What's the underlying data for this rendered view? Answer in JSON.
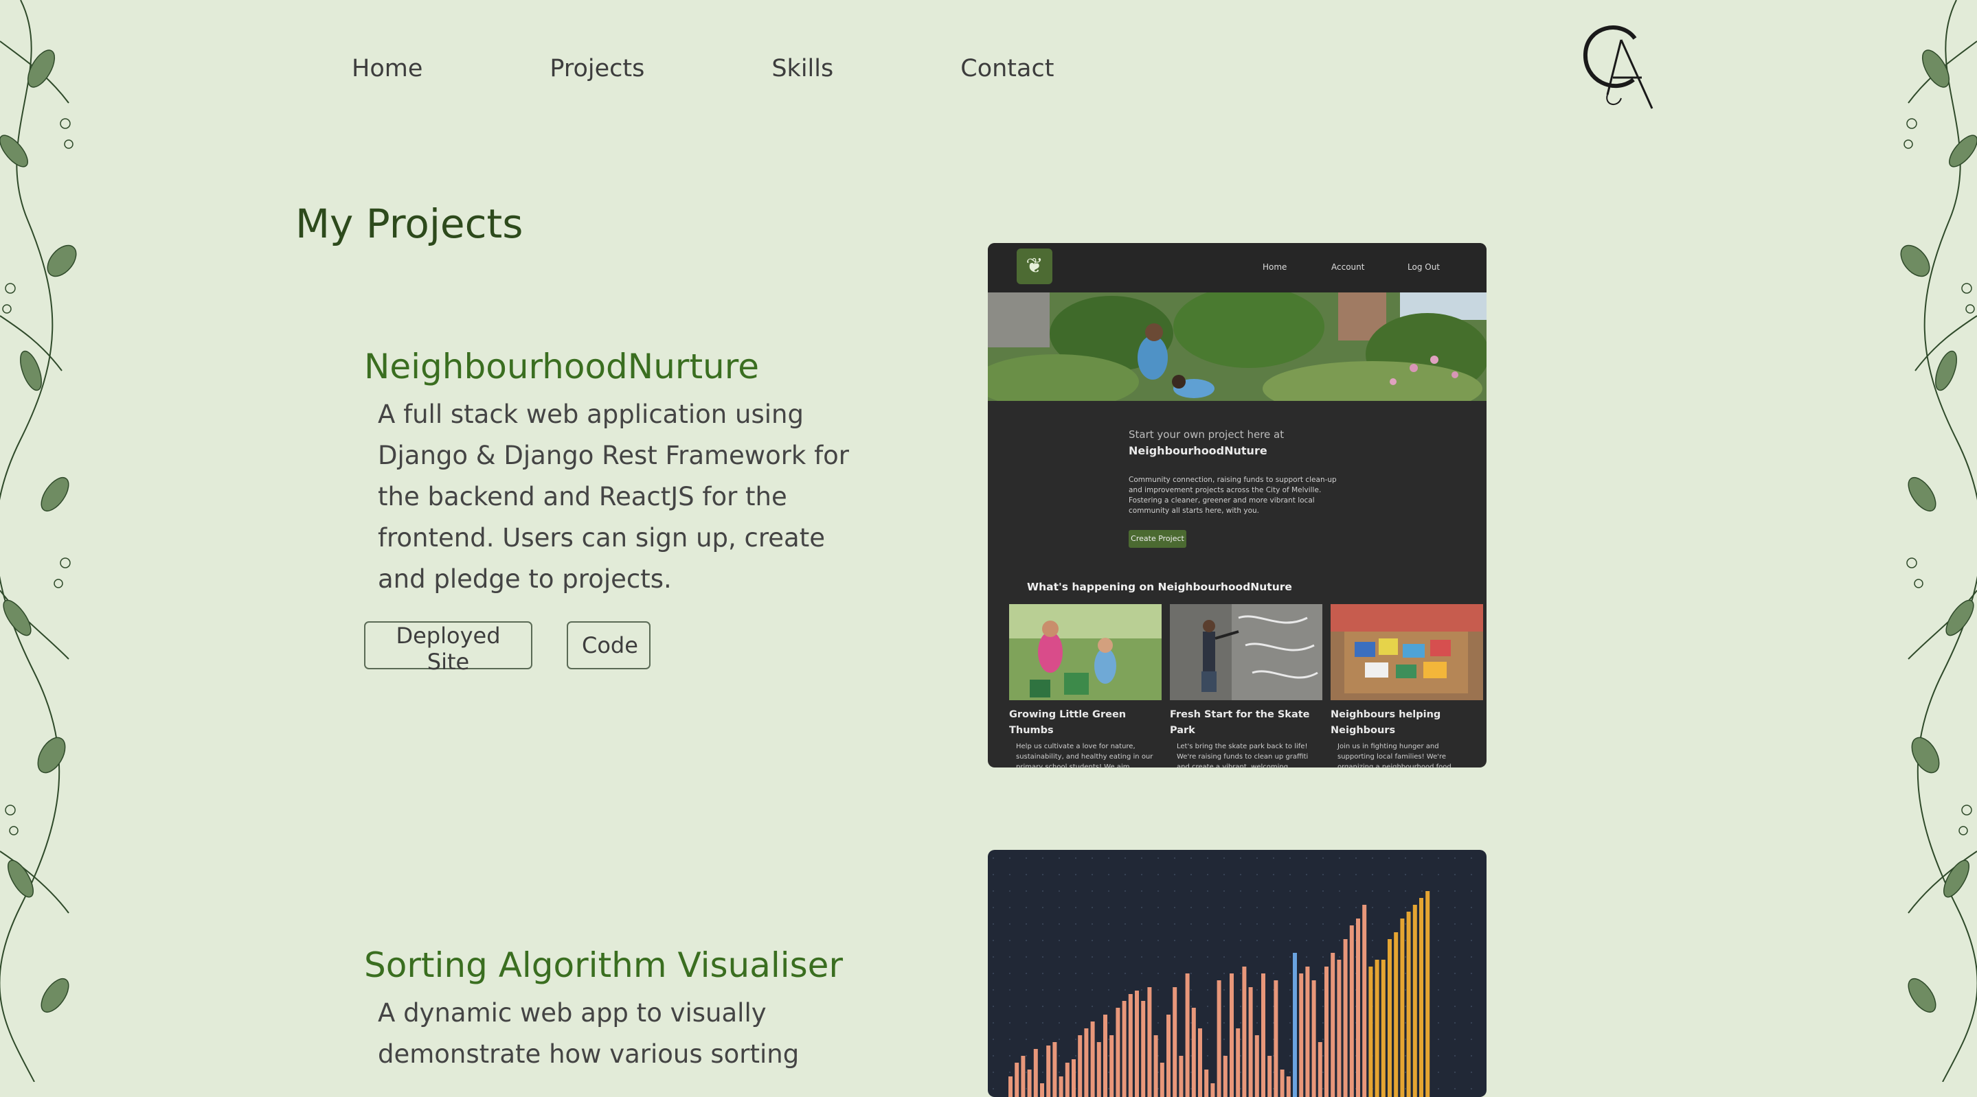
{
  "nav": {
    "links": [
      "Home",
      "Projects",
      "Skills",
      "Contact"
    ]
  },
  "logo": {
    "monogram": "CA"
  },
  "page_title": "My Projects",
  "projects": [
    {
      "title": "NeighbourhoodNurture",
      "description": "A full stack web application using Django & Django Rest Framework for the backend and ReactJS for the frontend. Users can sign up, create and pledge to projects.",
      "deployed_label": "Deployed Site",
      "code_label": "Code",
      "screenshot": {
        "nav_links": [
          "Home",
          "Account",
          "Log Out"
        ],
        "intro": "Start your own project here at",
        "brand": "NeighbourhoodNuture",
        "blurb": "Community connection, raising funds to support clean-up and improvement projects across the City of Melville. Fostering a cleaner, greener and more vibrant local community all starts here, with you.",
        "create_label": "Create Project",
        "happening_heading": "What's happening on NeighbourhoodNuture",
        "cards": [
          {
            "title": "Growing Little Green Thumbs",
            "desc": "Help us cultivate a love for nature, sustainability, and healthy eating in our primary school students! We aim"
          },
          {
            "title": "Fresh Start for the Skate Park",
            "desc": "Let's bring the skate park back to life! We're raising funds to clean up graffiti and create a vibrant, welcoming"
          },
          {
            "title": "Neighbours helping Neighbours",
            "desc": "Join us in fighting hunger and supporting local families! We're organizing a neighbourhood food"
          }
        ]
      }
    },
    {
      "title": "Sorting Algorithm Visualiser",
      "description": "A dynamic web app to visually demonstrate how various sorting"
    }
  ],
  "colors": {
    "background": "#e2ebd8",
    "project_title": "#3a6e20",
    "page_title": "#2d4a1c",
    "bar_default": "#e8977a",
    "bar_active": "#6aa3e0",
    "bar_sorted": "#e5a532"
  }
}
